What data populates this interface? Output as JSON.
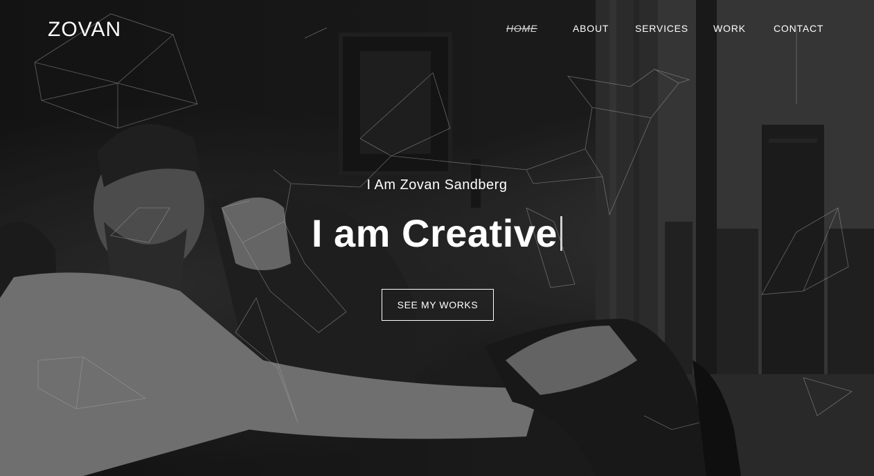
{
  "brand": {
    "logo": "ZOVAN"
  },
  "nav": {
    "items": [
      {
        "label": "HOME",
        "active": true
      },
      {
        "label": "ABOUT",
        "active": false
      },
      {
        "label": "SERVICES",
        "active": false
      },
      {
        "label": "WORK",
        "active": false
      },
      {
        "label": "CONTACT",
        "active": false
      }
    ]
  },
  "hero": {
    "subtitle": "I Am Zovan Sandberg",
    "headline": "I am Creative",
    "cta_label": "SEE MY WORKS"
  },
  "colors": {
    "text": "#ffffff",
    "background": "#1a1a1a",
    "lines": "#e6e6e6"
  }
}
